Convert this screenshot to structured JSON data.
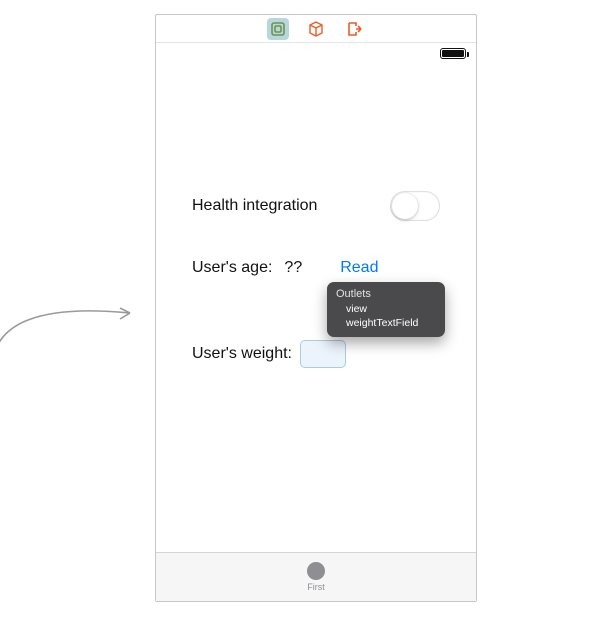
{
  "toolbar": {
    "icons": [
      "layers-icon",
      "cube-icon",
      "exit-icon"
    ],
    "selected_index": 0
  },
  "labels": {
    "health": "Health integration",
    "age": "User's age:",
    "age_value": "??",
    "read": "Read",
    "weight": "User's weight:"
  },
  "weight_field_value": "",
  "switch_on": false,
  "tabbar": {
    "first_label": "First"
  },
  "popover": {
    "title": "Outlets",
    "items": [
      "view",
      "weightTextField"
    ]
  },
  "colors": {
    "link": "#0079ff",
    "accent_orange": "#ee5b26",
    "accent_green": "#6e9445",
    "popover_bg": "#4a4a4c",
    "tab_gray": "#8e8e93"
  }
}
